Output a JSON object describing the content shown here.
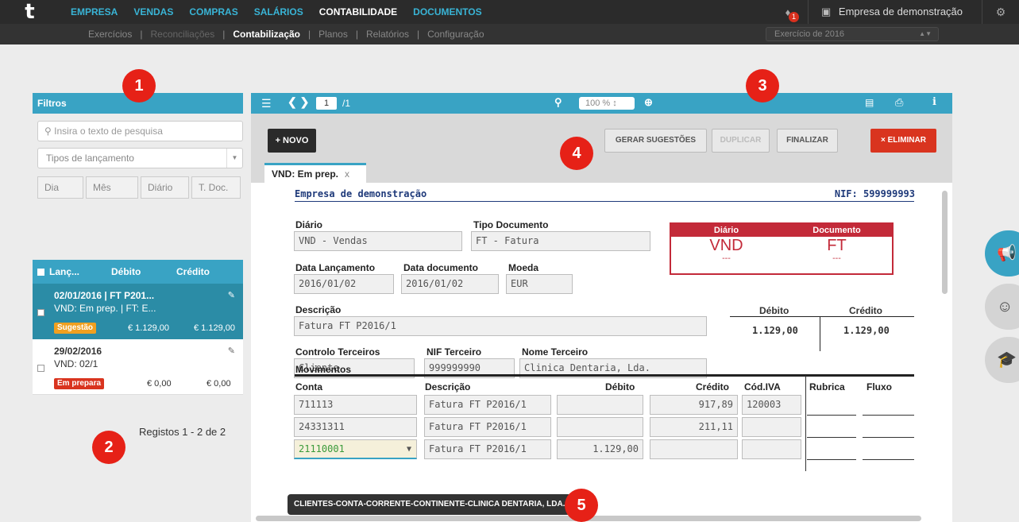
{
  "nav": {
    "logo": "t",
    "menu": [
      "EMPRESA",
      "VENDAS",
      "COMPRAS",
      "SALÁRIOS",
      "CONTABILIDADE",
      "DOCUMENTOS"
    ],
    "active_menu": "CONTABILIDADE",
    "notifications": "1",
    "company": "Empresa de demonstração",
    "submenu": [
      "Exercícios",
      "Reconciliações",
      "Contabilização",
      "Planos",
      "Relatórios",
      "Configuração"
    ],
    "active_sub": "Contabilização",
    "exercise": "Exercício de 2016"
  },
  "markers": [
    "1",
    "2",
    "3",
    "4",
    "5"
  ],
  "filters": {
    "title": "Filtros",
    "search_placeholder": "Insira o texto de pesquisa",
    "types": "Tipos de lançamento",
    "date_buttons": [
      "Dia",
      "Mês",
      "Diário",
      "T. Doc."
    ]
  },
  "list": {
    "headers": [
      "Lanç...",
      "Débito",
      "Crédito"
    ],
    "rows": [
      {
        "title": "02/01/2016 | FT P201...",
        "subtitle": "VND: Em prep. | FT: E...",
        "tag": "Sugestão",
        "debit": "€ 1.129,00",
        "credit": "€ 1.129,00"
      },
      {
        "title": "29/02/2016",
        "subtitle": "VND: 02/1",
        "tag": "Em prepara",
        "debit": "€ 0,00",
        "credit": "€ 0,00"
      }
    ],
    "records": "Registos 1 - 2 de 2"
  },
  "toolbar": {
    "page": "1",
    "page_of": "/1",
    "zoom": "100 %"
  },
  "actions": {
    "novo": "+ NOVO",
    "gerar": "GERAR SUGESTÕES",
    "duplicar": "DUPLICAR",
    "finalizar": "FINALIZAR",
    "eliminar": "× ELIMINAR"
  },
  "doc_tab": {
    "label": "VND: Em prep.",
    "close": "x"
  },
  "doc": {
    "company": "Empresa de demonstração",
    "nif": "NIF: 599999993",
    "diario_label": "Diário",
    "diario": "VND - Vendas",
    "tipo_label": "Tipo Documento",
    "tipo": "FT - Fatura",
    "box_diario_label": "Diário",
    "box_documento_label": "Documento",
    "box_diario": "VND",
    "box_documento": "FT",
    "box_dash": "---",
    "data_lanc_label": "Data Lançamento",
    "data_lanc": "2016/01/02",
    "data_doc_label": "Data documento",
    "data_doc": "2016/01/02",
    "moeda_label": "Moeda",
    "moeda": "EUR",
    "descricao_label": "Descrição",
    "descricao": "Fatura FT P2016/1",
    "debito_label": "Débito",
    "credito_label": "Crédito",
    "debito_total": "1.129,00",
    "credito_total": "1.129,00",
    "controlo_label": "Controlo Terceiros",
    "controlo": "Cliente",
    "nif_terc_label": "NIF Terceiro",
    "nif_terc": "999999990",
    "nome_terc_label": "Nome Terceiro",
    "nome_terc": "Clinica Dentaria, Lda.",
    "movimentos_label": "Movimentos",
    "mov_headers": [
      "Conta",
      "Descrição",
      "Débito",
      "Crédito",
      "Cód.IVA",
      "Rubrica",
      "Fluxo"
    ],
    "movimentos": [
      {
        "conta": "711113",
        "descricao": "Fatura FT P2016/1",
        "debito": "",
        "credito": "917,89",
        "iva": "120003"
      },
      {
        "conta": "24331311",
        "descricao": "Fatura FT P2016/1",
        "debito": "",
        "credito": "211,11",
        "iva": ""
      },
      {
        "conta": "21110001",
        "descricao": "Fatura FT P2016/1",
        "debito": "1.129,00",
        "credito": "",
        "iva": ""
      }
    ],
    "tooltip": "CLIENTES-CONTA-CORRENTE-CONTINENTE-CLINICA DENTARIA, LDA."
  },
  "colors": {
    "accent": "#39a3c4",
    "nav_bg": "#2b2b2b",
    "danger": "#d9341f",
    "marker": "#e62117"
  },
  "icons": [
    "bell-icon",
    "briefcase-icon",
    "gear-icon",
    "search-icon",
    "edit-icon",
    "menu-icon",
    "zoom-out-icon",
    "zoom-in-icon",
    "pdf-icon",
    "print-icon",
    "info-icon",
    "megaphone-icon",
    "support-icon",
    "graduation-cap-icon"
  ]
}
